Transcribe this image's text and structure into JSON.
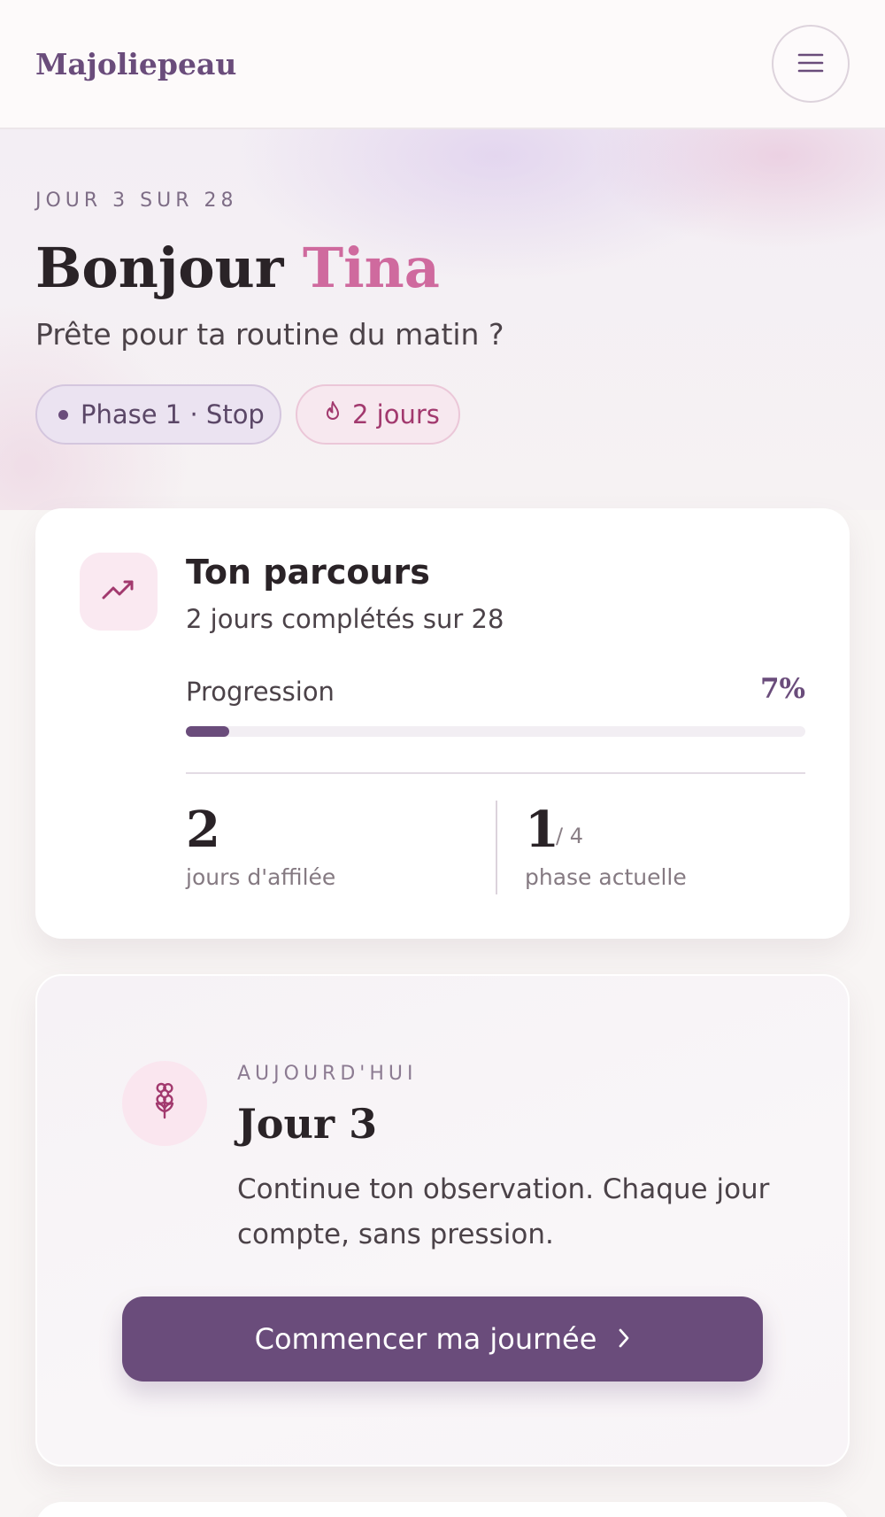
{
  "header": {
    "brand": "Majoliepeau",
    "menu_icon": "hamburger-menu-icon"
  },
  "hero": {
    "eyebrow": "JOUR 3 SUR 28",
    "greeting": "Bonjour",
    "name": "Tina",
    "subtitle": "Prête pour ta routine du matin ?",
    "phase_chip": "Phase 1 · Stop",
    "streak_chip": "2 jours",
    "streak_icon": "flame-icon"
  },
  "journey": {
    "icon": "trending-up-icon",
    "title": "Ton parcours",
    "subtitle": "2 jours complétés sur 28",
    "progress_label": "Progression",
    "progress_value": "7%",
    "progress_fraction": 0.07,
    "stats": [
      {
        "value": "2",
        "label": "jours d'affilée"
      },
      {
        "value": "1",
        "of": "/ 4",
        "label": "phase actuelle"
      }
    ]
  },
  "today": {
    "icon": "flower-icon",
    "eyebrow": "AUJOURD'HUI",
    "title": "Jour 3",
    "text": "Continue ton observation. Chaque jour compte, sans pression.",
    "cta_label": "Commencer ma journée",
    "cta_icon": "chevron-right-icon"
  },
  "colors": {
    "accent": "#6a4c7b",
    "pink": "#cf6a9e",
    "background": "#f8f5f4"
  }
}
